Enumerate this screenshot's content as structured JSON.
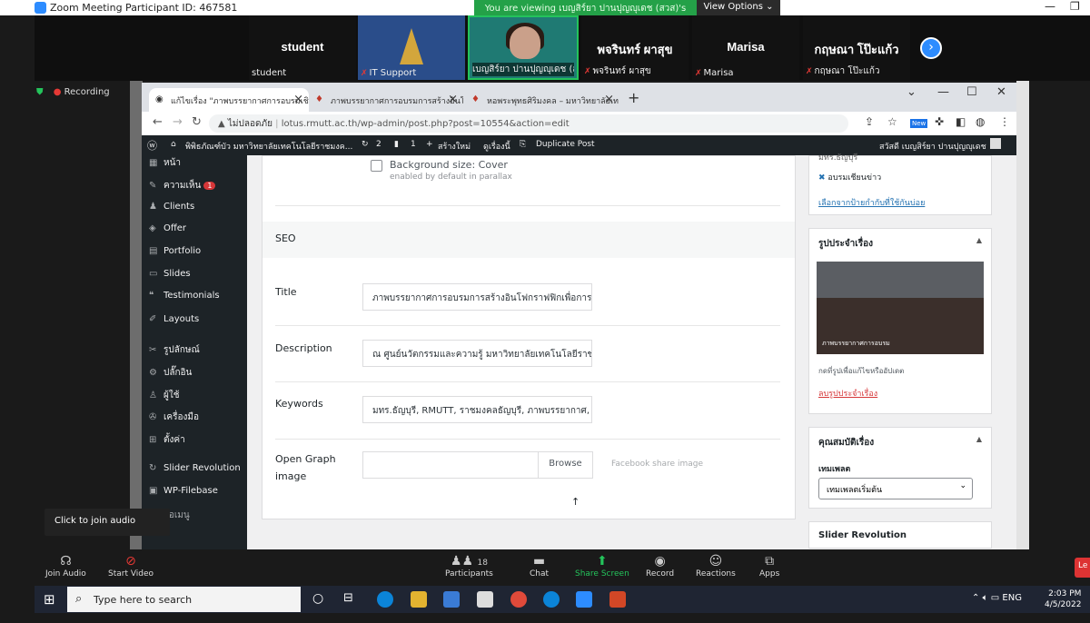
{
  "zoom": {
    "window_title": "Zoom Meeting Participant ID: 467581",
    "share_banner": "You are viewing เบญสิร์ยา ปานปุญญุเดช (สวส)'s screen",
    "view_options": "View Options ⌄",
    "recording": "Recording",
    "join_tip": "Click to join audio",
    "tiles": [
      {
        "big": "student",
        "label": "student"
      },
      {
        "big": "",
        "label": "IT Support"
      },
      {
        "big": "",
        "label": "เบญสิร์ยา ปานปุญญุเดช (สวส)"
      },
      {
        "big": "พจรินทร์ ผาสุข",
        "label": "พจรินทร์ ผาสุข"
      },
      {
        "big": "Marisa",
        "label": "Marisa"
      },
      {
        "big": "กฤษณา โป๊ะแก้ว",
        "label": "กฤษณา โป๊ะแก้ว"
      }
    ],
    "toolbar": {
      "join_audio": "Join Audio",
      "start_video": "Start Video",
      "participants": "Participants",
      "participants_count": "18",
      "chat": "Chat",
      "share_screen": "Share Screen",
      "record": "Record",
      "reactions": "Reactions",
      "apps": "Apps",
      "leave": "Le"
    }
  },
  "browser": {
    "tabs": [
      {
        "label": "แก้ไขเรื่อง \"ภาพบรรยากาศการอบรมเชิ"
      },
      {
        "label": "ภาพบรรยากาศการอบรมการสร้างอินโฟ"
      },
      {
        "label": "หอพระพุทธศิริมงคล – มหาวิทยาลัยเท"
      }
    ],
    "insecure": "ไม่ปลอดภัย",
    "url": "lotus.rmutt.ac.th/wp-admin/post.php?post=10554&action=edit",
    "new_badge": "New"
  },
  "wp": {
    "adminbar": {
      "site": "พิพิธภัณฑ์บัว มหาวิทยาลัยเทคโนโลยีราชมงค...",
      "updates": "2",
      "comments": "1",
      "new": "สร้างใหม่",
      "view": "ดูเรื่องนี้",
      "duplicate": "Duplicate Post",
      "greeting": "สวัสดี เบญสิร์ยา ปานปุญญุเดช"
    },
    "menu": [
      {
        "icon": "▦",
        "label": "หน้า"
      },
      {
        "icon": "✎",
        "label": "ความเห็น",
        "badge": "1"
      },
      {
        "icon": "♟",
        "label": "Clients"
      },
      {
        "icon": "◈",
        "label": "Offer"
      },
      {
        "icon": "▤",
        "label": "Portfolio"
      },
      {
        "icon": "▭",
        "label": "Slides"
      },
      {
        "icon": "❝",
        "label": "Testimonials"
      },
      {
        "icon": "✐",
        "label": "Layouts"
      },
      {
        "icon": "✂",
        "label": "รูปลักษณ์"
      },
      {
        "icon": "⚙",
        "label": "ปลั๊กอิน"
      },
      {
        "icon": "♙",
        "label": "ผู้ใช้"
      },
      {
        "icon": "✇",
        "label": "เครื่องมือ"
      },
      {
        "icon": "⊞",
        "label": "ตั้งค่า"
      },
      {
        "icon": "↻",
        "label": "Slider Revolution"
      },
      {
        "icon": "▣",
        "label": "WP-Filebase"
      },
      {
        "icon": "",
        "label": "ย่อเมนู"
      }
    ],
    "background_size_label": "Background size: Cover",
    "background_size_hint": "enabled by default in parallax",
    "seo_heading": "SEO",
    "fields": {
      "title_label": "Title",
      "title_value": "ภาพบรรยากาศการอบรมการสร้างอินโฟกราฟฟิกเพื่อการสื่",
      "description_label": "Description",
      "description_value": "ณ ศูนย์นวัตกรรมและความรู้ มหาวิทยาลัยเทคโนโลยีราชม",
      "keywords_label": "Keywords",
      "keywords_value": "มทร.ธัญบุรี, RMUTT, ราชมงคลธัญบุรี, ภาพบรรยากาศ, Ph",
      "og_label_1": "Open Graph",
      "og_label_2": "image",
      "browse": "Browse",
      "og_hint": "Facebook share image"
    },
    "sidebar": {
      "cat_partial": "มทร.ธัญบุรี",
      "cat_2": "อบรมเชียนข่าว",
      "choose_link": "เลือกจากป้ายกำกับที่ใช้กันบ่อย",
      "featured_title": "รูปประจำเรื่อง",
      "photo_caption": "ภาพบรรยากาศการอบรม",
      "click_to_edit": "กดที่รูปเพื่อแก้ไขหรืออัปเดต",
      "remove_image": "ลบรูปประจำเรื่อง",
      "attributes_title": "คุณสมบัติเรื่อง",
      "template_label": "เทมเพลต",
      "template_value": "เทมเพลตเริ่มต้น",
      "slider_title": "Slider Revolution"
    }
  },
  "taskbar": {
    "search": "Type here to search",
    "lang": "ENG",
    "time": "2:03 PM",
    "date": "4/5/2022"
  }
}
